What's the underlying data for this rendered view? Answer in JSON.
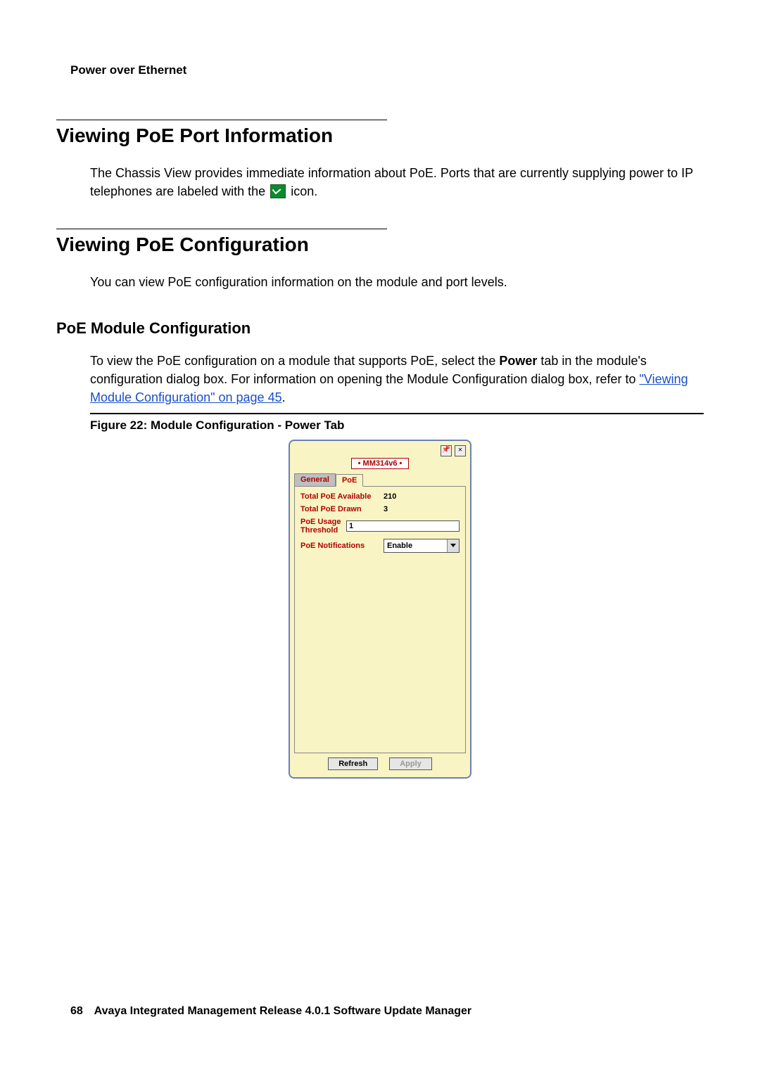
{
  "header": {
    "running": "Power over Ethernet"
  },
  "section1": {
    "title": "Viewing PoE Port Information",
    "para_a": "The Chassis View provides immediate information about PoE. Ports that are currently supplying power to IP telephones are labeled with the ",
    "para_b": " icon."
  },
  "section2": {
    "title": "Viewing PoE Configuration",
    "para": "You can view PoE configuration information on the module and port levels."
  },
  "subsection": {
    "title": "PoE Module Configuration",
    "para_a": "To view the PoE configuration on a module that supports PoE, select the ",
    "para_bold": "Power",
    "para_b": " tab in the module's configuration dialog box. For information on opening the Module Configuration dialog box, refer to ",
    "link": "\"Viewing Module Configuration\" on page 45",
    "para_c": "."
  },
  "figure": {
    "caption": "Figure 22: Module Configuration - Power Tab",
    "dialog": {
      "module": "• MM314v6 •",
      "tabs": {
        "general": "General",
        "poe": "PoE"
      },
      "fields": {
        "total_available_label": "Total PoE Available",
        "total_available_value": "210",
        "total_drawn_label": "Total PoE Drawn",
        "total_drawn_value": "3",
        "threshold_label": "PoE Usage Threshold",
        "threshold_value": "1",
        "notifications_label": "PoE Notifications",
        "notifications_value": "Enable"
      },
      "buttons": {
        "refresh": "Refresh",
        "apply": "Apply"
      }
    }
  },
  "footer": {
    "page": "68",
    "text": "Avaya Integrated Management Release 4.0.1 Software Update Manager"
  }
}
